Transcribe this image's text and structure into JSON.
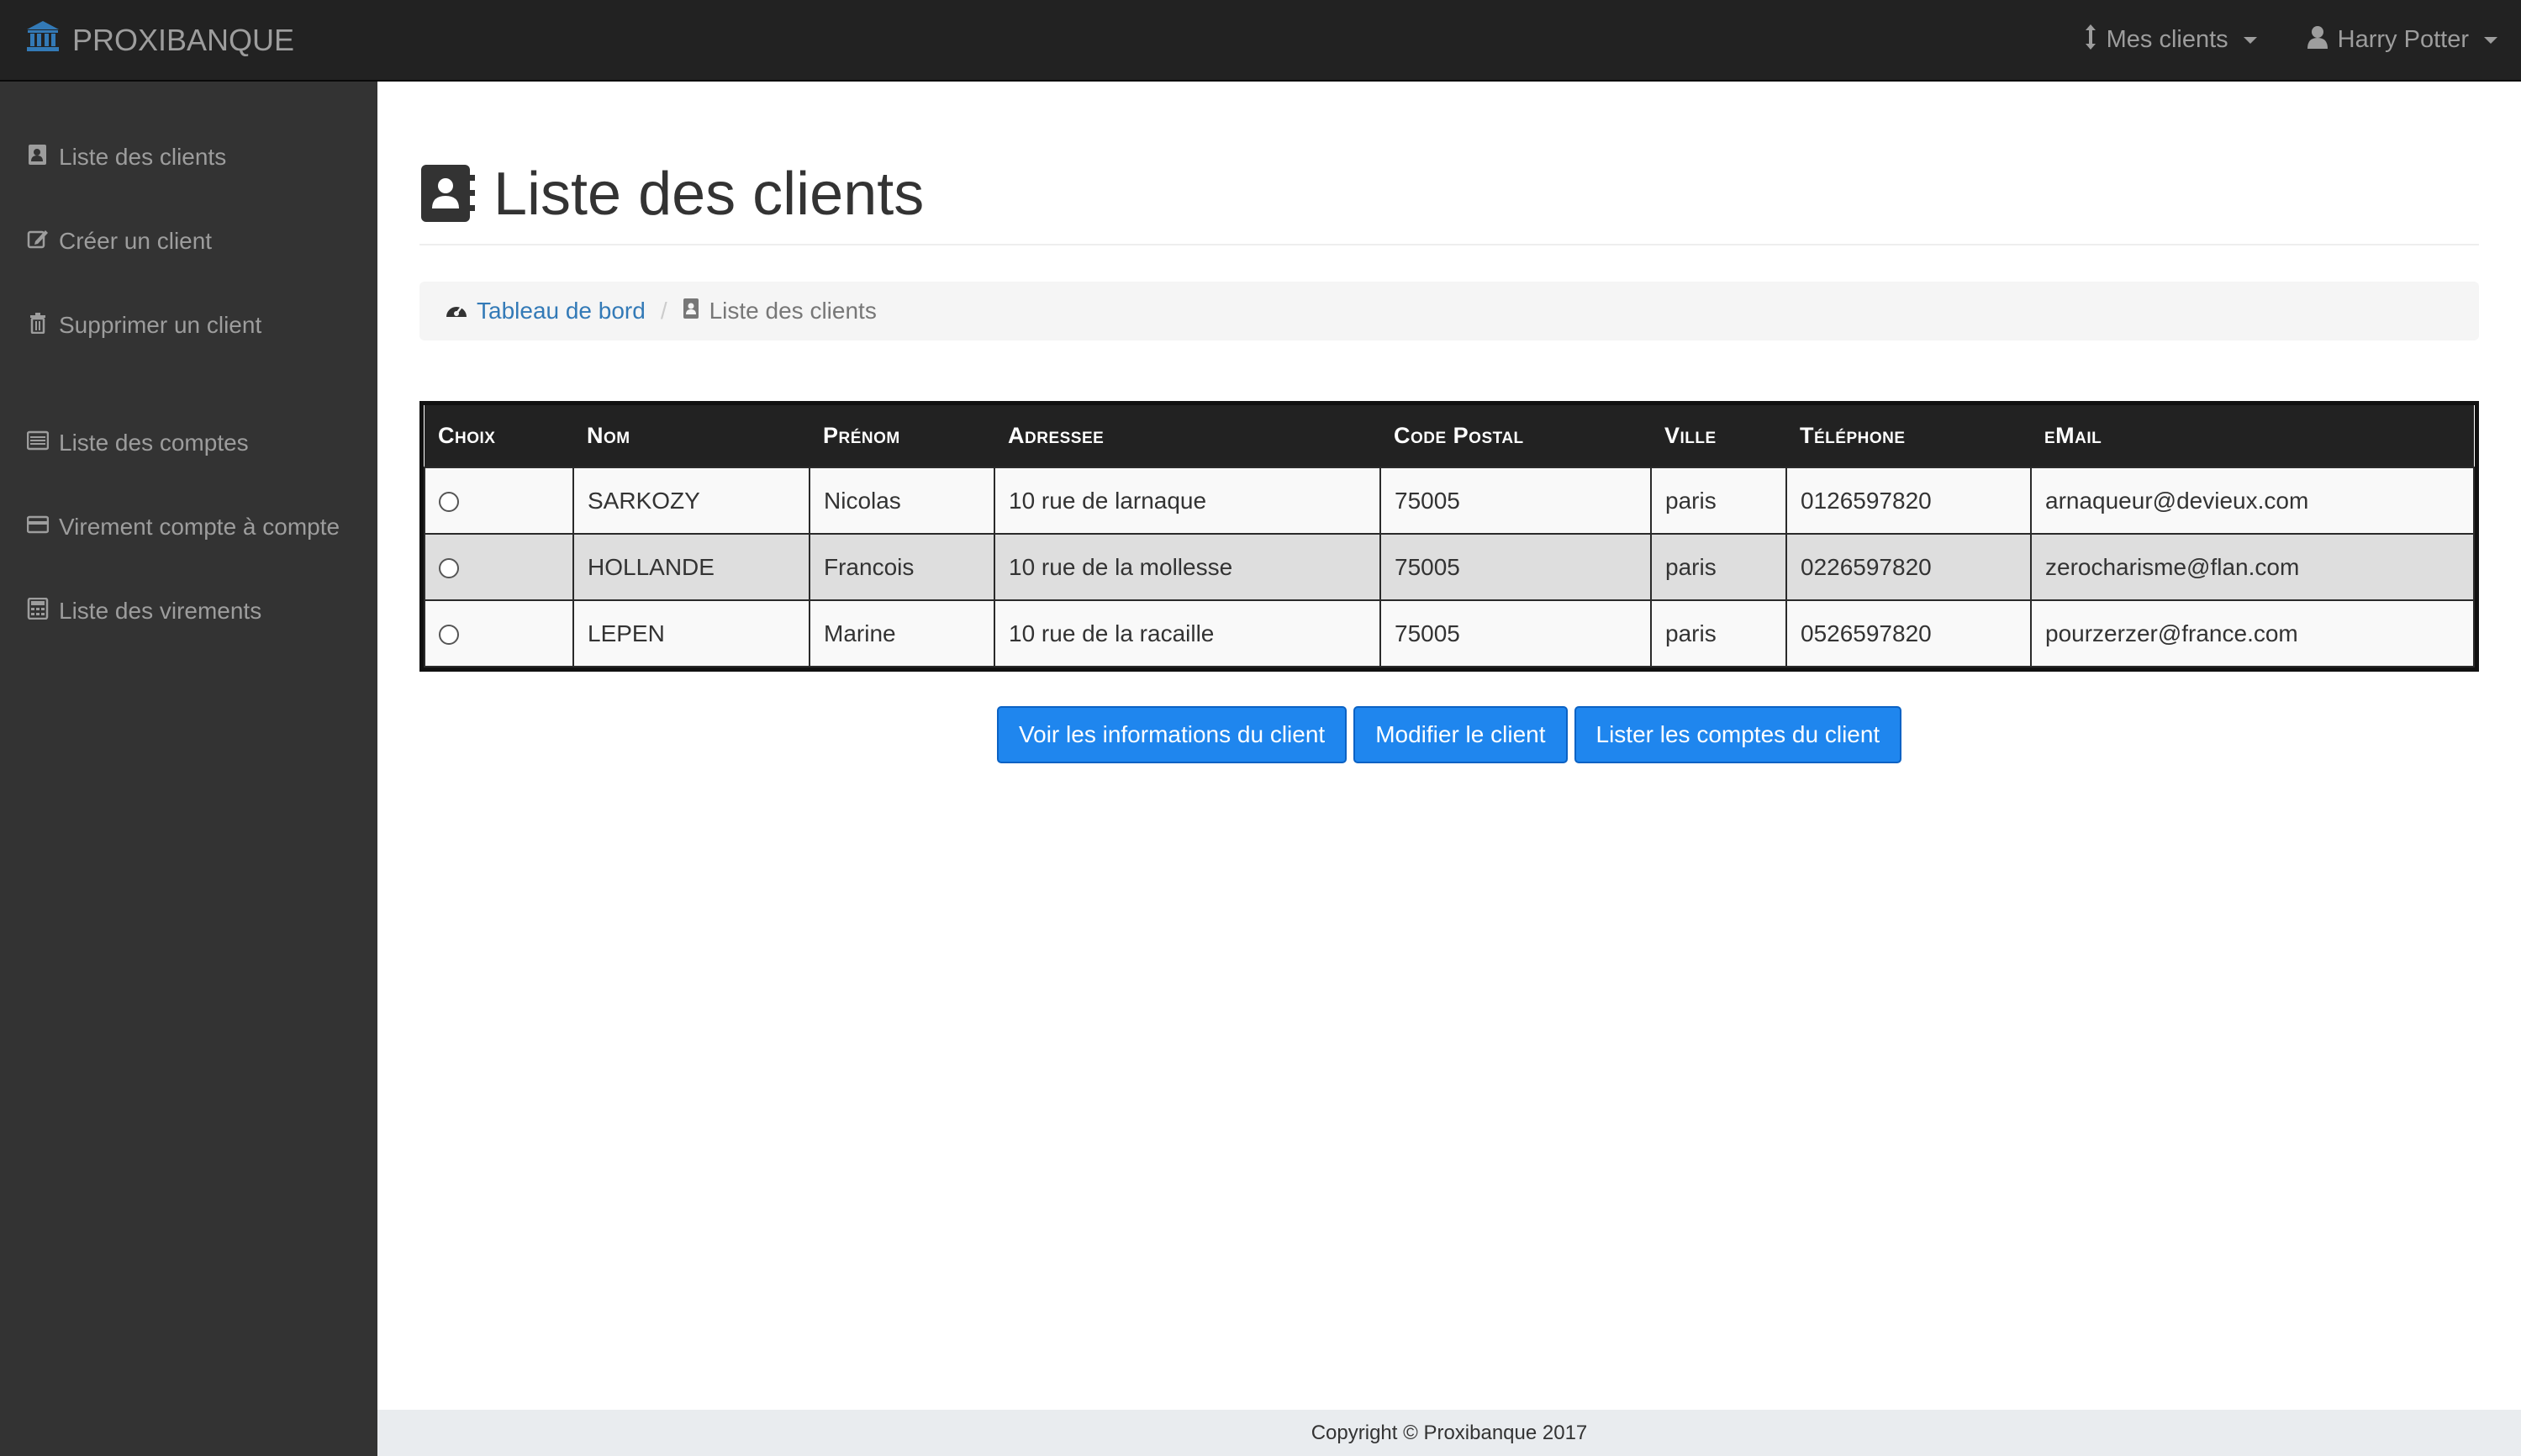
{
  "navbar": {
    "brand": "PROXIBANQUE",
    "brand_icon": "bank-icon",
    "menu_clients": "Mes clients",
    "user_name": "Harry Potter",
    "colors": {
      "background": "#222222",
      "text": "#9d9d9d",
      "brand_icon": "#337ab7"
    }
  },
  "sidebar": {
    "items": [
      {
        "label": "Liste des clients",
        "icon": "address-book-icon"
      },
      {
        "label": "Créer un client",
        "icon": "edit-icon"
      },
      {
        "label": "Supprimer un client",
        "icon": "trash-icon"
      },
      {
        "label": "Liste des comptes",
        "icon": "list-icon"
      },
      {
        "label": "Virement compte à compte",
        "icon": "credit-card-icon"
      },
      {
        "label": "Liste des virements",
        "icon": "calculator-icon"
      }
    ]
  },
  "page": {
    "title": "Liste des clients",
    "title_icon": "address-book-icon"
  },
  "breadcrumb": {
    "home_label": "Tableau de bord",
    "home_icon": "dashboard-icon",
    "current_label": "Liste des clients",
    "current_icon": "address-book-icon"
  },
  "table": {
    "headers": [
      "Choix",
      "Nom",
      "Prénom",
      "Adressee",
      "Code Postal",
      "Ville",
      "Téléphone",
      "eMail"
    ],
    "rows": [
      {
        "nom": "SARKOZY",
        "prenom": "Nicolas",
        "adresse": "10 rue de larnaque",
        "code_postal": "75005",
        "ville": "paris",
        "telephone": "0126597820",
        "email": "arnaqueur@devieux.com"
      },
      {
        "nom": "HOLLANDE",
        "prenom": "Francois",
        "adresse": "10 rue de la mollesse",
        "code_postal": "75005",
        "ville": "paris",
        "telephone": "0226597820",
        "email": "zerocharisme@flan.com"
      },
      {
        "nom": "LEPEN",
        "prenom": "Marine",
        "adresse": "10 rue de la racaille",
        "code_postal": "75005",
        "ville": "paris",
        "telephone": "0526597820",
        "email": "pourzerzer@france.com"
      }
    ]
  },
  "actions": {
    "view_info": "Voir les informations du client",
    "edit_client": "Modifier le client",
    "list_accounts": "Lister les comptes du client",
    "button_color": "#1f86ee"
  },
  "footer": {
    "text": "Copyright © Proxibanque 2017"
  }
}
